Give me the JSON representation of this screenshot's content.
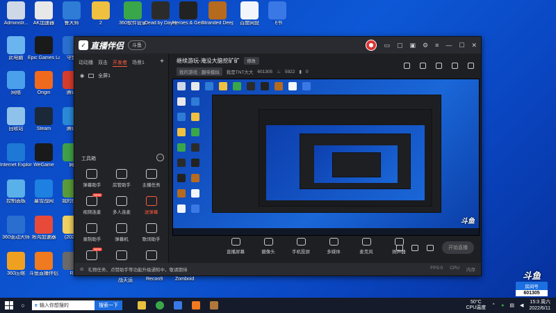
{
  "desktop": {
    "icons": [
      {
        "label": "Administr...",
        "color": "#cfd8e6"
      },
      {
        "label": "AK加速器",
        "color": "#e8e8e8"
      },
      {
        "label": "鲁大师",
        "color": "#2e7cd6"
      },
      {
        "label": "2",
        "color": "#f0c040"
      },
      {
        "label": "360软件管家",
        "color": "#3aa64a"
      },
      {
        "label": "Dead by Daylight",
        "color": "#2b2b2b"
      },
      {
        "label": "Heroes & Generals",
        "color": "#222222"
      },
      {
        "label": "Stranded Deep",
        "color": "#b56a1e"
      },
      {
        "label": "百度网盘",
        "color": "#f2f6fb"
      },
      {
        "label": "飞书",
        "color": "#3a78e6"
      },
      {
        "label": "此电脑",
        "color": "#6ab4f0"
      },
      {
        "label": "Epic Games Launcher",
        "color": "#1a1a1a"
      },
      {
        "label": "守望",
        "color": "#2a6fcf"
      },
      {
        "label": "网络",
        "color": "#4aa0ea"
      },
      {
        "label": "Origin",
        "color": "#f06a1e"
      },
      {
        "label": "腾讯",
        "color": "#d83c2c"
      },
      {
        "label": "回收站",
        "color": "#8fc2ea"
      },
      {
        "label": "Steam",
        "color": "#1b2838"
      },
      {
        "label": "腾讯",
        "color": "#2a8ad8"
      },
      {
        "label": "Internet Explorer",
        "color": "#1e78d6"
      },
      {
        "label": "WeGame",
        "color": "#1a1a1a"
      },
      {
        "label": "网",
        "color": "#3fa048"
      },
      {
        "label": "控制面板",
        "color": "#5ab0e8"
      },
      {
        "label": "暴雪战网",
        "color": "#1e80e0"
      },
      {
        "label": "我的世界",
        "color": "#5a9c3a"
      },
      {
        "label": "360驱动大师",
        "color": "#2a6fd0"
      },
      {
        "label": "将鸿加速器",
        "color": "#e84a3a"
      },
      {
        "label": "(2021-",
        "color": "#f0d060"
      },
      {
        "label": "360压缩",
        "color": "#f0a020"
      },
      {
        "label": "斗鱼直播伴侣",
        "color": "#f07a20"
      },
      {
        "label": "R",
        "color": "#6a6a6a"
      }
    ]
  },
  "app": {
    "logo_text": "直播伴侣",
    "pill": "斗鱼",
    "scene_tabs": [
      "动动播",
      "双击",
      "开发者",
      "场景1"
    ],
    "active_scene_tab": 2,
    "scene_add": "+",
    "scene_item": "全屏1",
    "tools_title": "工具箱",
    "tools_more": "···",
    "tools": [
      {
        "label": "弹幕助手",
        "red": false,
        "new": ""
      },
      {
        "label": "房管助手",
        "red": false,
        "new": ""
      },
      {
        "label": "主播任务",
        "red": false,
        "new": ""
      },
      {
        "label": "视频连麦",
        "red": false,
        "new": "NEW"
      },
      {
        "label": "多人连麦",
        "red": false,
        "new": ""
      },
      {
        "label": "送弹幕",
        "red": true,
        "new": ""
      },
      {
        "label": "录制助手",
        "red": false,
        "new": ""
      },
      {
        "label": "弹幕机",
        "red": false,
        "new": ""
      },
      {
        "label": "歌词助手",
        "red": false,
        "new": ""
      },
      {
        "label": "",
        "red": false,
        "new": "NEW"
      },
      {
        "label": "",
        "red": false,
        "new": ""
      },
      {
        "label": "",
        "red": false,
        "new": ""
      }
    ],
    "stream": {
      "title": "继续游玩-淹没大脑挖矿矿",
      "edit_label": "修改",
      "category": "我的游戏 · 趣味模拟",
      "host": "我是TNT大大",
      "room_id": "601305",
      "viewers": "5922",
      "likes": "0"
    },
    "controls": [
      "直播屏幕",
      "摄像头",
      "手机投屏",
      "多媒体",
      "麦克风",
      "扬声器"
    ],
    "start_button": "开始直播",
    "status_text": "礼物任务、点赞助手等功能升级通知中，敬请期待",
    "status_stats": [
      "FPS:0",
      "CPU",
      "内存"
    ],
    "below_labels": [
      "战天运",
      "Recon9",
      "Zomboid"
    ]
  },
  "preview": {
    "watermark": "斗鱼"
  },
  "taskbar": {
    "search_placeholder": "输入你想搜的",
    "search_button": "搜索一下",
    "temp": "50°C",
    "temp_label": "CPU温度",
    "time": "15:3 周六",
    "date": "2022/6/11",
    "tray_icons": [
      "up-chevron",
      "wechat",
      "network",
      "volume"
    ]
  },
  "douyu_badge": {
    "logo": "斗鱼",
    "room_label": "房间号",
    "room_number": "601305"
  }
}
